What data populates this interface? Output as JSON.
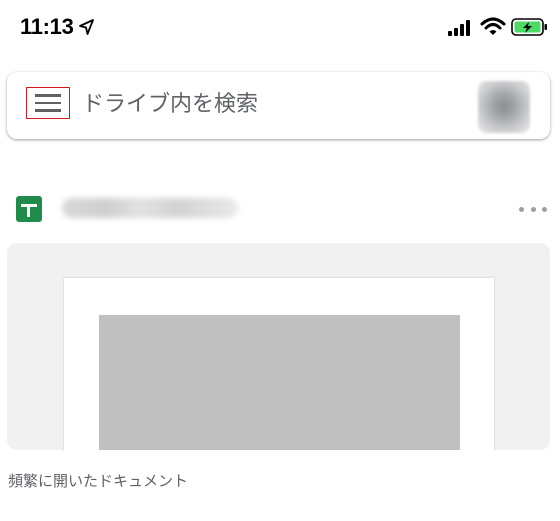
{
  "status_bar": {
    "time": "11:13",
    "icons": [
      "location-arrow-icon",
      "cellular-signal-icon",
      "wifi-icon",
      "battery-charging-icon"
    ],
    "battery_color": "#4cd964"
  },
  "search": {
    "placeholder": "ドライブ内を検索",
    "menu_icon": "hamburger-menu-icon",
    "highlight_color": "#d71920"
  },
  "file": {
    "type_icon": "google-sheets-icon",
    "type_color": "#208b4a",
    "name": "",
    "more_icon": "more-horizontal-icon"
  },
  "section": {
    "label": "頻繁に開いたドキュメント"
  }
}
